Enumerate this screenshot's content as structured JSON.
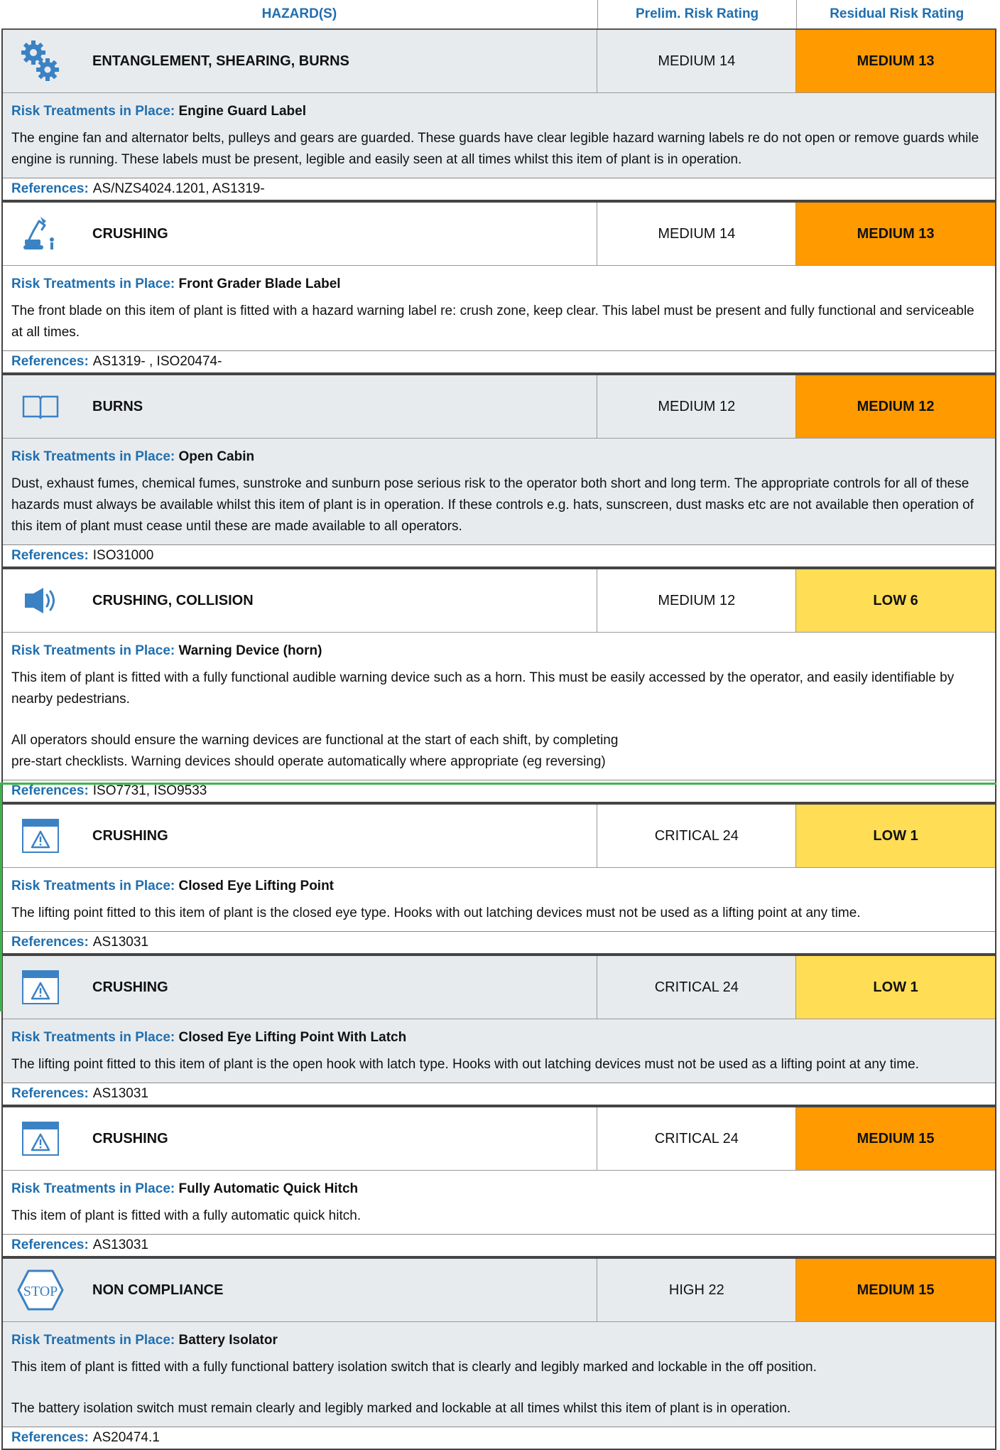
{
  "header": {
    "hazards": "HAZARD(S)",
    "prelim": "Prelim. Risk Rating",
    "residual": "Residual Risk Rating"
  },
  "labels": {
    "risk_treatments": "Risk Treatments in Place:",
    "references": "References:"
  },
  "colors": {
    "medium": "#ff9a00",
    "low": "#ffdd55",
    "grey_bg": "#e8ebee",
    "white_bg": "#ffffff",
    "accent_blue": "#1f6fb0"
  },
  "rows": [
    {
      "icon": "gears-icon",
      "hazard": "ENTANGLEMENT, SHEARING, BURNS",
      "prelim": "MEDIUM 14",
      "residual": "MEDIUM 13",
      "residual_level": "medium",
      "bg": "grey",
      "treatment": "Engine Guard Label",
      "paragraphs": [
        "The engine fan and alternator belts, pulleys and gears are guarded. These guards have clear legible hazard warning labels re do not open or remove guards while engine is running. These labels must be present, legible and easily seen at all times whilst this item of plant is in operation."
      ],
      "references": "AS/NZS4024.1201, AS1319-"
    },
    {
      "icon": "excavator-icon",
      "hazard": "CRUSHING",
      "prelim": "MEDIUM 14",
      "residual": "MEDIUM 13",
      "residual_level": "medium",
      "bg": "white",
      "treatment": "Front Grader Blade Label",
      "paragraphs": [
        "The front blade on this item of plant is fitted with a hazard warning label re: crush zone, keep clear. This label must be present and fully functional and serviceable at all times."
      ],
      "references": "AS1319- , ISO20474-"
    },
    {
      "icon": "book-icon",
      "hazard": "BURNS",
      "prelim": "MEDIUM 12",
      "residual": "MEDIUM 12",
      "residual_level": "medium",
      "bg": "grey",
      "treatment": "Open Cabin",
      "paragraphs": [
        "Dust, exhaust fumes, chemical fumes, sunstroke and sunburn pose serious risk to the operator both short and long term. The appropriate controls for all of these hazards must always be available whilst this item of plant is in operation. If these controls e.g. hats, sunscreen, dust masks etc are not available then operation of this item of plant must cease until these are made available to all operators."
      ],
      "references": "ISO31000"
    },
    {
      "icon": "speaker-icon",
      "hazard": "CRUSHING, COLLISION",
      "prelim": "MEDIUM 12",
      "residual": "LOW 6",
      "residual_level": "low",
      "bg": "white",
      "treatment": "Warning Device (horn)",
      "paragraphs": [
        "This item of plant is fitted with a fully functional audible warning device such as a horn. This must be easily accessed by the operator, and easily identifiable by nearby pedestrians.",
        "All operators should ensure the warning devices are functional at the start of each shift, by completing\npre-start checklists. Warning devices should operate automatically where appropriate (eg reversing)"
      ],
      "references": "ISO7731, ISO9533"
    },
    {
      "icon": "warning-window-icon",
      "hazard": "CRUSHING",
      "prelim": "CRITICAL 24",
      "residual": "LOW 1",
      "residual_level": "low",
      "bg": "white",
      "treatment": "Closed Eye Lifting Point",
      "paragraphs": [
        "The lifting point fitted to this item of plant is the closed eye type. Hooks with out latching devices must not be used as a lifting point at any time."
      ],
      "references": "AS13031"
    },
    {
      "icon": "warning-window-icon",
      "hazard": "CRUSHING",
      "prelim": "CRITICAL 24",
      "residual": "LOW 1",
      "residual_level": "low",
      "bg": "grey",
      "treatment": "Closed Eye Lifting Point With Latch",
      "paragraphs": [
        "The lifting point fitted to this item of plant is the open hook with latch type. Hooks with out latching devices must not be used as a lifting point at any time."
      ],
      "references": "AS13031"
    },
    {
      "icon": "warning-window-icon",
      "hazard": "CRUSHING",
      "prelim": "CRITICAL 24",
      "residual": "MEDIUM 15",
      "residual_level": "medium",
      "bg": "white",
      "treatment": "Fully Automatic Quick Hitch",
      "paragraphs": [
        "This item of plant is fitted with a fully automatic quick hitch."
      ],
      "references": "AS13031"
    },
    {
      "icon": "stop-sign-icon",
      "hazard": "NON COMPLIANCE",
      "prelim": "HIGH 22",
      "residual": "MEDIUM 15",
      "residual_level": "medium",
      "bg": "grey",
      "treatment": "Battery Isolator",
      "stop_text": "STOP",
      "paragraphs": [
        "This item of plant is fitted with a fully functional battery isolation switch that is clearly and legibly marked and lockable in the off position.",
        "The battery isolation switch must remain clearly and legibly marked and lockable at all times whilst this item of plant is in operation."
      ],
      "references": "AS20474.1"
    }
  ]
}
